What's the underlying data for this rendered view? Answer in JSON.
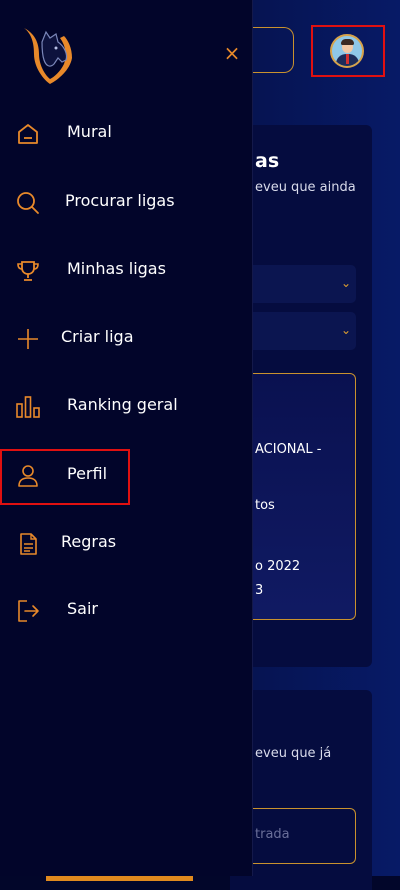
{
  "background": {
    "section1_title": "as",
    "section1_text": "eveu que ainda",
    "league_card_lines": [
      "ACIONAL -",
      "tos",
      "o 2022",
      "3"
    ],
    "section2_text": "eveu que já",
    "input_text": "trada"
  },
  "header": {
    "avatar": "user-avatar"
  },
  "drawer": {
    "close_symbol": "×",
    "items": [
      {
        "label": "Mural",
        "icon": "home-icon"
      },
      {
        "label": "Procurar ligas",
        "icon": "search-icon"
      },
      {
        "label": "Minhas ligas",
        "icon": "trophy-icon"
      },
      {
        "label": "Criar liga",
        "icon": "plus-icon"
      },
      {
        "label": "Ranking geral",
        "icon": "bar-chart-icon"
      },
      {
        "label": "Perfil",
        "icon": "user-icon"
      },
      {
        "label": "Regras",
        "icon": "document-icon"
      },
      {
        "label": "Sair",
        "icon": "logout-icon"
      }
    ]
  },
  "colors": {
    "accent": "#e8892a",
    "drawer_bg": "#02052a",
    "highlight_box": "#e01010"
  }
}
